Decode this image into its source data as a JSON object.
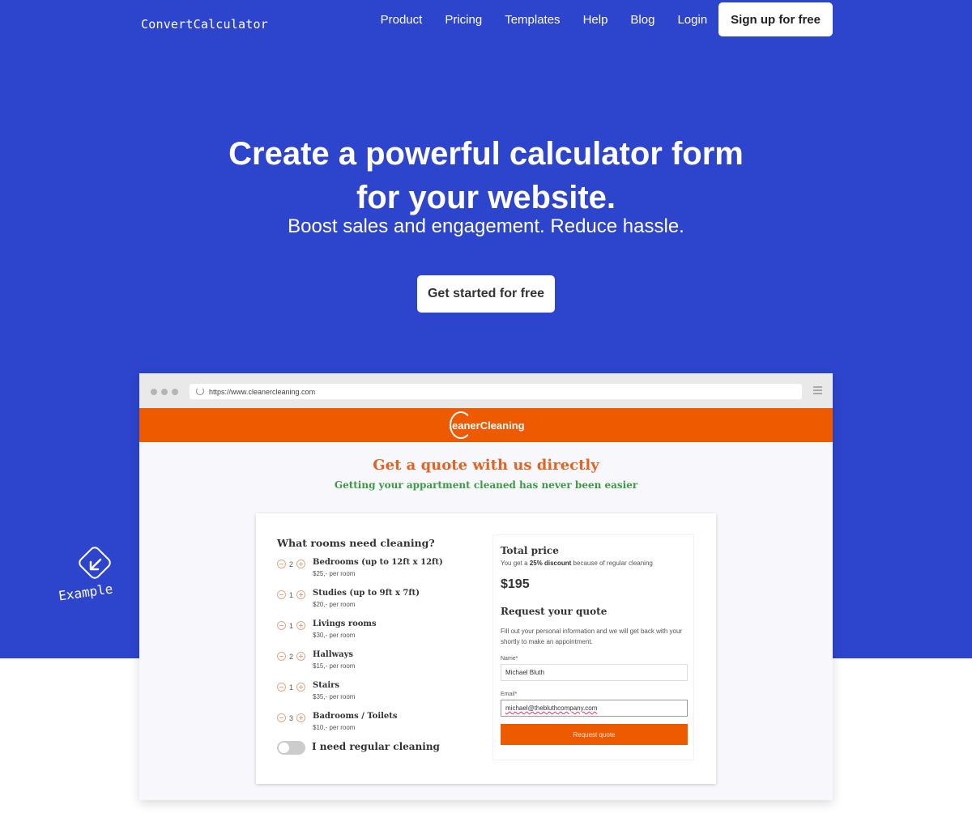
{
  "nav": {
    "logo": "ConvertCalculator",
    "links": [
      "Product",
      "Pricing",
      "Templates",
      "Help",
      "Blog",
      "Login"
    ],
    "signup_label": "Sign up for free"
  },
  "hero": {
    "title_line1": "Create a powerful calculator form",
    "title_line2": "for your website.",
    "subtitle": "Boost sales and engagement. Reduce hassle.",
    "cta_label": "Get started for free",
    "background_color": "#2d44cd"
  },
  "example": {
    "label": "Example",
    "icon": "arrow-down-left-icon"
  },
  "browser": {
    "url": "https://www.cleanercleaning.com",
    "site_logo": "leanerCleaning",
    "brand_color": "#ee5a00",
    "heading": "Get a quote with us directly",
    "subheading": "Getting your appartment cleaned has never been easier",
    "form": {
      "rooms_heading": "What rooms need cleaning?",
      "rooms": [
        {
          "name": "Bedrooms (up to 12ft x 12ft)",
          "price": "$25,- per room",
          "qty": "2"
        },
        {
          "name": "Studies (up to 9ft x 7ft)",
          "price": "$20,- per room",
          "qty": "1"
        },
        {
          "name": "Livings rooms",
          "price": "$30,- per room",
          "qty": "1"
        },
        {
          "name": "Hallways",
          "price": "$15,- per room",
          "qty": "2"
        },
        {
          "name": "Stairs",
          "price": "$35,- per room",
          "qty": "1"
        },
        {
          "name": "Badrooms / Toilets",
          "price": "$10,- per room",
          "qty": "3"
        }
      ],
      "toggle_label": "I need regular cleaning",
      "toggle_on": false,
      "total_title": "Total price",
      "discount_prefix": "You get a ",
      "discount_bold": "25% discount",
      "discount_suffix": " because of regular cleaning",
      "total_value": "$195",
      "request_title": "Request your quote",
      "request_desc": "Fill out your personal information and we will get back with your shortly to make an appointment.",
      "name_label": "Name*",
      "name_value": "Michael Bluth",
      "email_label": "Email*",
      "email_value": "michael@thebluthcompany.com",
      "submit_label": "Request quote"
    }
  }
}
